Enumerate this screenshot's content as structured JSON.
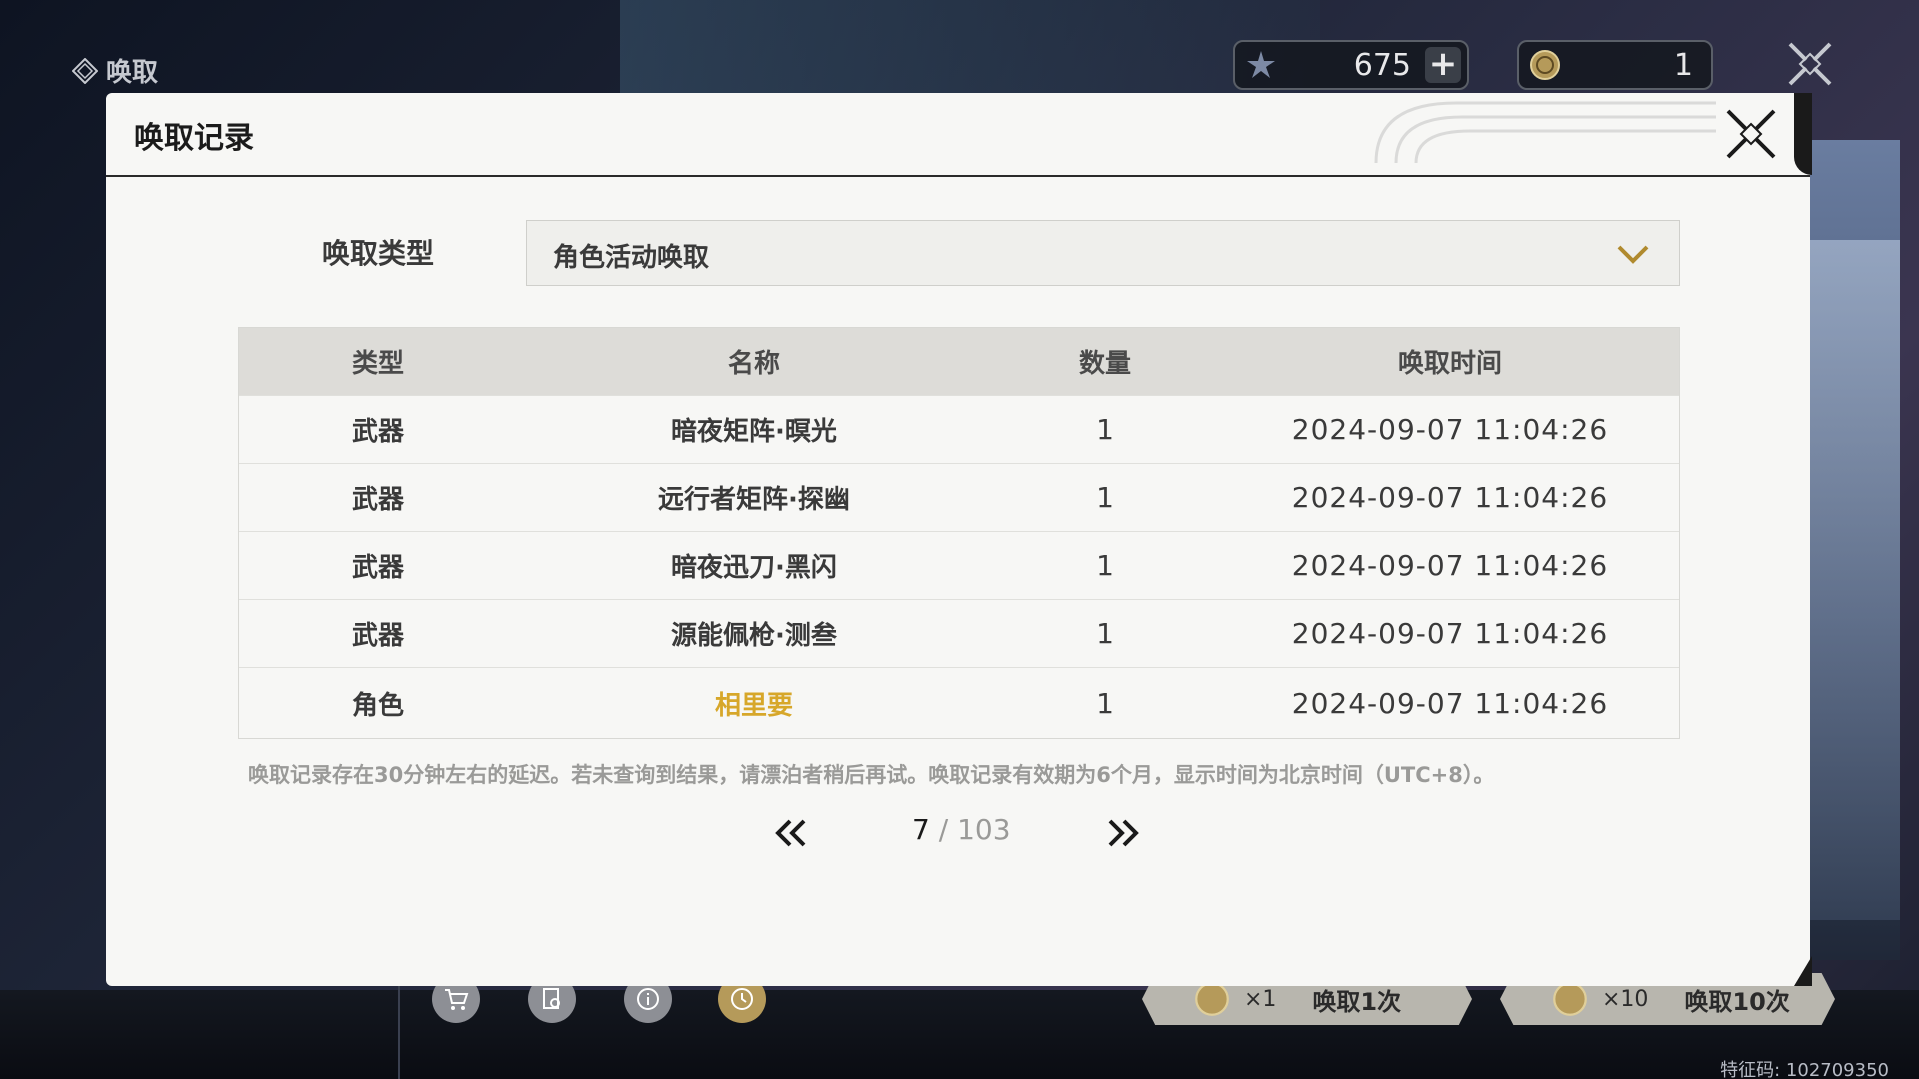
{
  "app": {
    "title": "唤取",
    "currencies": [
      {
        "icon": "star-shard-icon",
        "value": "675"
      },
      {
        "icon": "coin-icon",
        "value": "1"
      }
    ],
    "feature_code": "特征码: 102709350"
  },
  "bottom_bar": {
    "icons": [
      "cart-icon",
      "search-document-icon",
      "info-icon",
      "history-clock-icon"
    ],
    "summon_once": {
      "multiplier": "×1",
      "label": "唤取1次"
    },
    "summon_ten": {
      "multiplier": "×10",
      "label": "唤取10次"
    }
  },
  "modal": {
    "title": "唤取记录",
    "filter": {
      "label": "唤取类型",
      "value": "角色活动唤取"
    },
    "table": {
      "headers": [
        "类型",
        "名称",
        "数量",
        "唤取时间"
      ],
      "rows": [
        {
          "type": "武器",
          "name": "暗夜矩阵·暝光",
          "qty": "1",
          "time": "2024-09-07 11:04:26",
          "highlight": false
        },
        {
          "type": "武器",
          "name": "远行者矩阵·探幽",
          "qty": "1",
          "time": "2024-09-07 11:04:26",
          "highlight": false
        },
        {
          "type": "武器",
          "name": "暗夜迅刀·黑闪",
          "qty": "1",
          "time": "2024-09-07 11:04:26",
          "highlight": false
        },
        {
          "type": "武器",
          "name": "源能佩枪·测叁",
          "qty": "1",
          "time": "2024-09-07 11:04:26",
          "highlight": false
        },
        {
          "type": "角色",
          "name": "相里要",
          "qty": "1",
          "time": "2024-09-07 11:04:26",
          "highlight": true
        }
      ]
    },
    "notice": "唤取记录存在30分钟左右的延迟。若未查询到结果，请漂泊者稍后再试。唤取记录有效期为6个月，显示时间为北京时间（UTC+8）。",
    "pager": {
      "current": "7",
      "separator": " / ",
      "total": "103"
    }
  },
  "colors": {
    "highlight_gold": "#d7a72a",
    "modal_bg": "#f7f7f5",
    "table_header_bg": "#dddcd8"
  }
}
